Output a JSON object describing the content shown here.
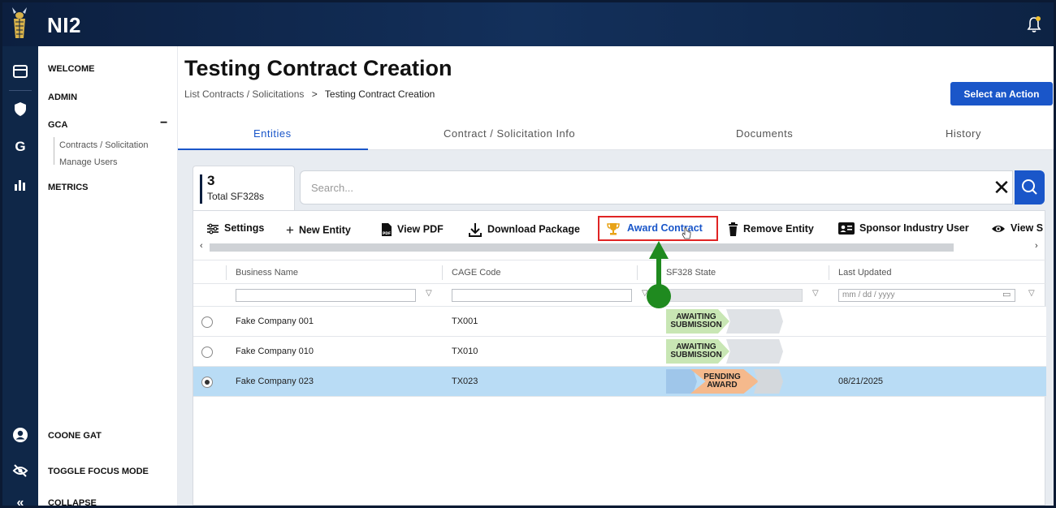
{
  "app": {
    "title": "NI2"
  },
  "nav": {
    "welcome": "WELCOME",
    "admin": "ADMIN",
    "gca": "GCA",
    "gca_toggle": "−",
    "contracts": "Contracts / Solicitation",
    "manage_users": "Manage Users",
    "metrics": "METRICS",
    "user": "COONE GAT",
    "focus": "TOGGLE FOCUS MODE",
    "collapse": "COLLAPSE"
  },
  "page": {
    "title": "Testing Contract Creation",
    "breadcrumb_parent": "List Contracts / Solicitations",
    "breadcrumb_sep": ">",
    "breadcrumb_current": "Testing Contract Creation",
    "action_button": "Select an Action"
  },
  "tabs": [
    "Entities",
    "Contract / Solicitation Info",
    "Documents",
    "History"
  ],
  "summary": {
    "count": "3",
    "label": "Total SF328s"
  },
  "search": {
    "placeholder": "Search..."
  },
  "toolbar": {
    "settings": "Settings",
    "new_entity": "New Entity",
    "view_pdf": "View PDF",
    "download": "Download Package",
    "award": "Award Contract",
    "remove": "Remove Entity",
    "sponsor": "Sponsor Industry User",
    "view": "View S"
  },
  "grid": {
    "columns": [
      "Business Name",
      "CAGE Code",
      "SF328 State",
      "Last Updated"
    ],
    "date_placeholder": "mm / dd / yyyy",
    "rows": [
      {
        "business": "Fake Company 001",
        "cage": "TX001",
        "state_line1": "AWAITING",
        "state_line2": "SUBMISSION",
        "updated": "",
        "selected": false
      },
      {
        "business": "Fake Company 010",
        "cage": "TX010",
        "state_line1": "AWAITING",
        "state_line2": "SUBMISSION",
        "updated": "",
        "selected": false
      },
      {
        "business": "Fake Company 023",
        "cage": "TX023",
        "state_line1": "PENDING",
        "state_line2": "AWARD",
        "updated": "08/21/2025",
        "selected": true
      }
    ]
  },
  "colors": {
    "primary": "#1a56c9",
    "topbar": "#0c1f3f",
    "awaiting": "#c8e6b4",
    "pending": "#f5b98c",
    "selected_row": "#b9dcf5",
    "annotation": "#1f8a1f",
    "highlight": "#e02424"
  }
}
